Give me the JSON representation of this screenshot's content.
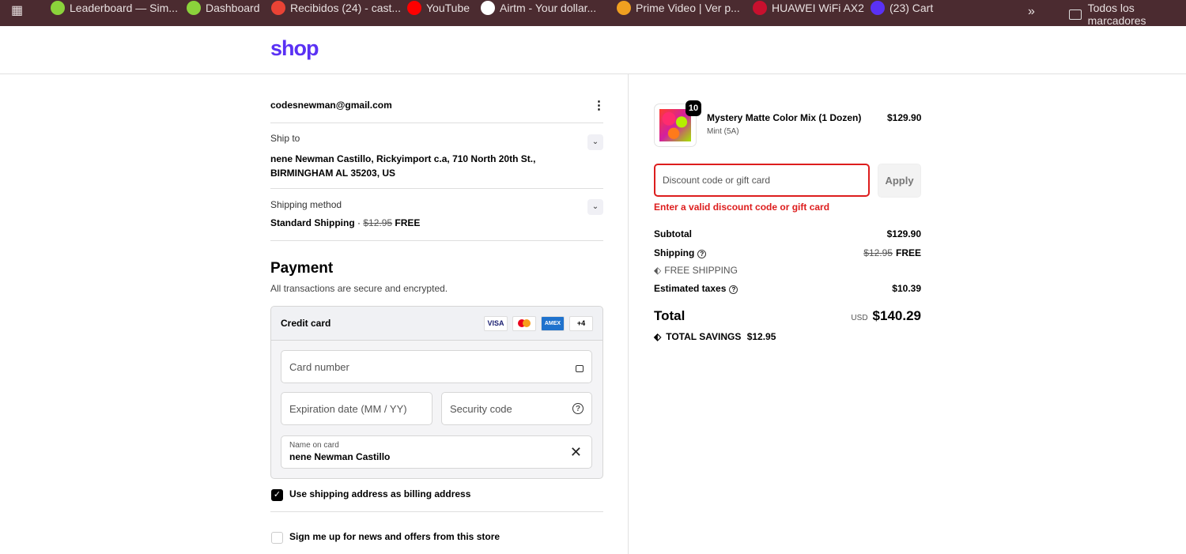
{
  "bookmarks": [
    {
      "label": "Leaderboard — Sim...",
      "color": "#8bd33b"
    },
    {
      "label": "Dashboard",
      "color": "#8bd33b"
    },
    {
      "label": "Recibidos (24) - cast...",
      "color": "#ea4335"
    },
    {
      "label": "YouTube",
      "color": "#ff0000"
    },
    {
      "label": "Airtm - Your dollar...",
      "color": "#ffffff"
    },
    {
      "label": "Prime Video | Ver p...",
      "color": "#f0a020"
    },
    {
      "label": "HUAWEI WiFi AX2",
      "color": "#c8102e"
    },
    {
      "label": "(23) Cart",
      "color": "#5a31f4"
    }
  ],
  "bookmarks_more": "»",
  "bookmarks_folder": "Todos los marcadores",
  "logo": "shop",
  "contact": {
    "email": "codesnewman@gmail.com",
    "menu": "⋮"
  },
  "ship_to": {
    "label": "Ship to",
    "line1": "nene Newman Castillo, Rickyimport c.a, 710 North 20th St.,",
    "line2": "BIRMINGHAM AL 35203, US"
  },
  "shipping_method": {
    "label": "Shipping method",
    "name": "Standard Shipping",
    "sep": "·",
    "old_price": "$12.95",
    "price": "FREE"
  },
  "payment": {
    "title": "Payment",
    "subtitle": "All transactions are secure and encrypted.",
    "method": "Credit card",
    "cards": [
      "VISA",
      "MC",
      "AMEX"
    ],
    "more_cards": "+4",
    "card_number_placeholder": "Card number",
    "expiry_placeholder": "Expiration date (MM / YY)",
    "security_placeholder": "Security code",
    "name_label": "Name on card",
    "name_value": "nene Newman Castillo"
  },
  "billing_checkbox": {
    "label": "Use shipping address as billing address",
    "checked": true
  },
  "newsletter_checkbox": {
    "label": "Sign me up for news and offers from this store",
    "checked": false
  },
  "item": {
    "quantity": "10",
    "name": "Mystery Matte Color Mix (1 Dozen)",
    "variant": "Mint (5A)",
    "price": "$129.90"
  },
  "discount": {
    "placeholder": "Discount code or gift card",
    "apply": "Apply",
    "error": "Enter a valid discount code or gift card",
    "error_color": "#dd1d1d"
  },
  "summary": {
    "subtotal_label": "Subtotal",
    "subtotal": "$129.90",
    "shipping_label": "Shipping",
    "shipping_old": "$12.95",
    "shipping": "FREE",
    "free_shipping_tag": "FREE SHIPPING",
    "taxes_label": "Estimated taxes",
    "taxes": "$10.39",
    "total_label": "Total",
    "currency": "USD",
    "total": "$140.29",
    "savings_label": "TOTAL SAVINGS",
    "savings": "$12.95"
  }
}
